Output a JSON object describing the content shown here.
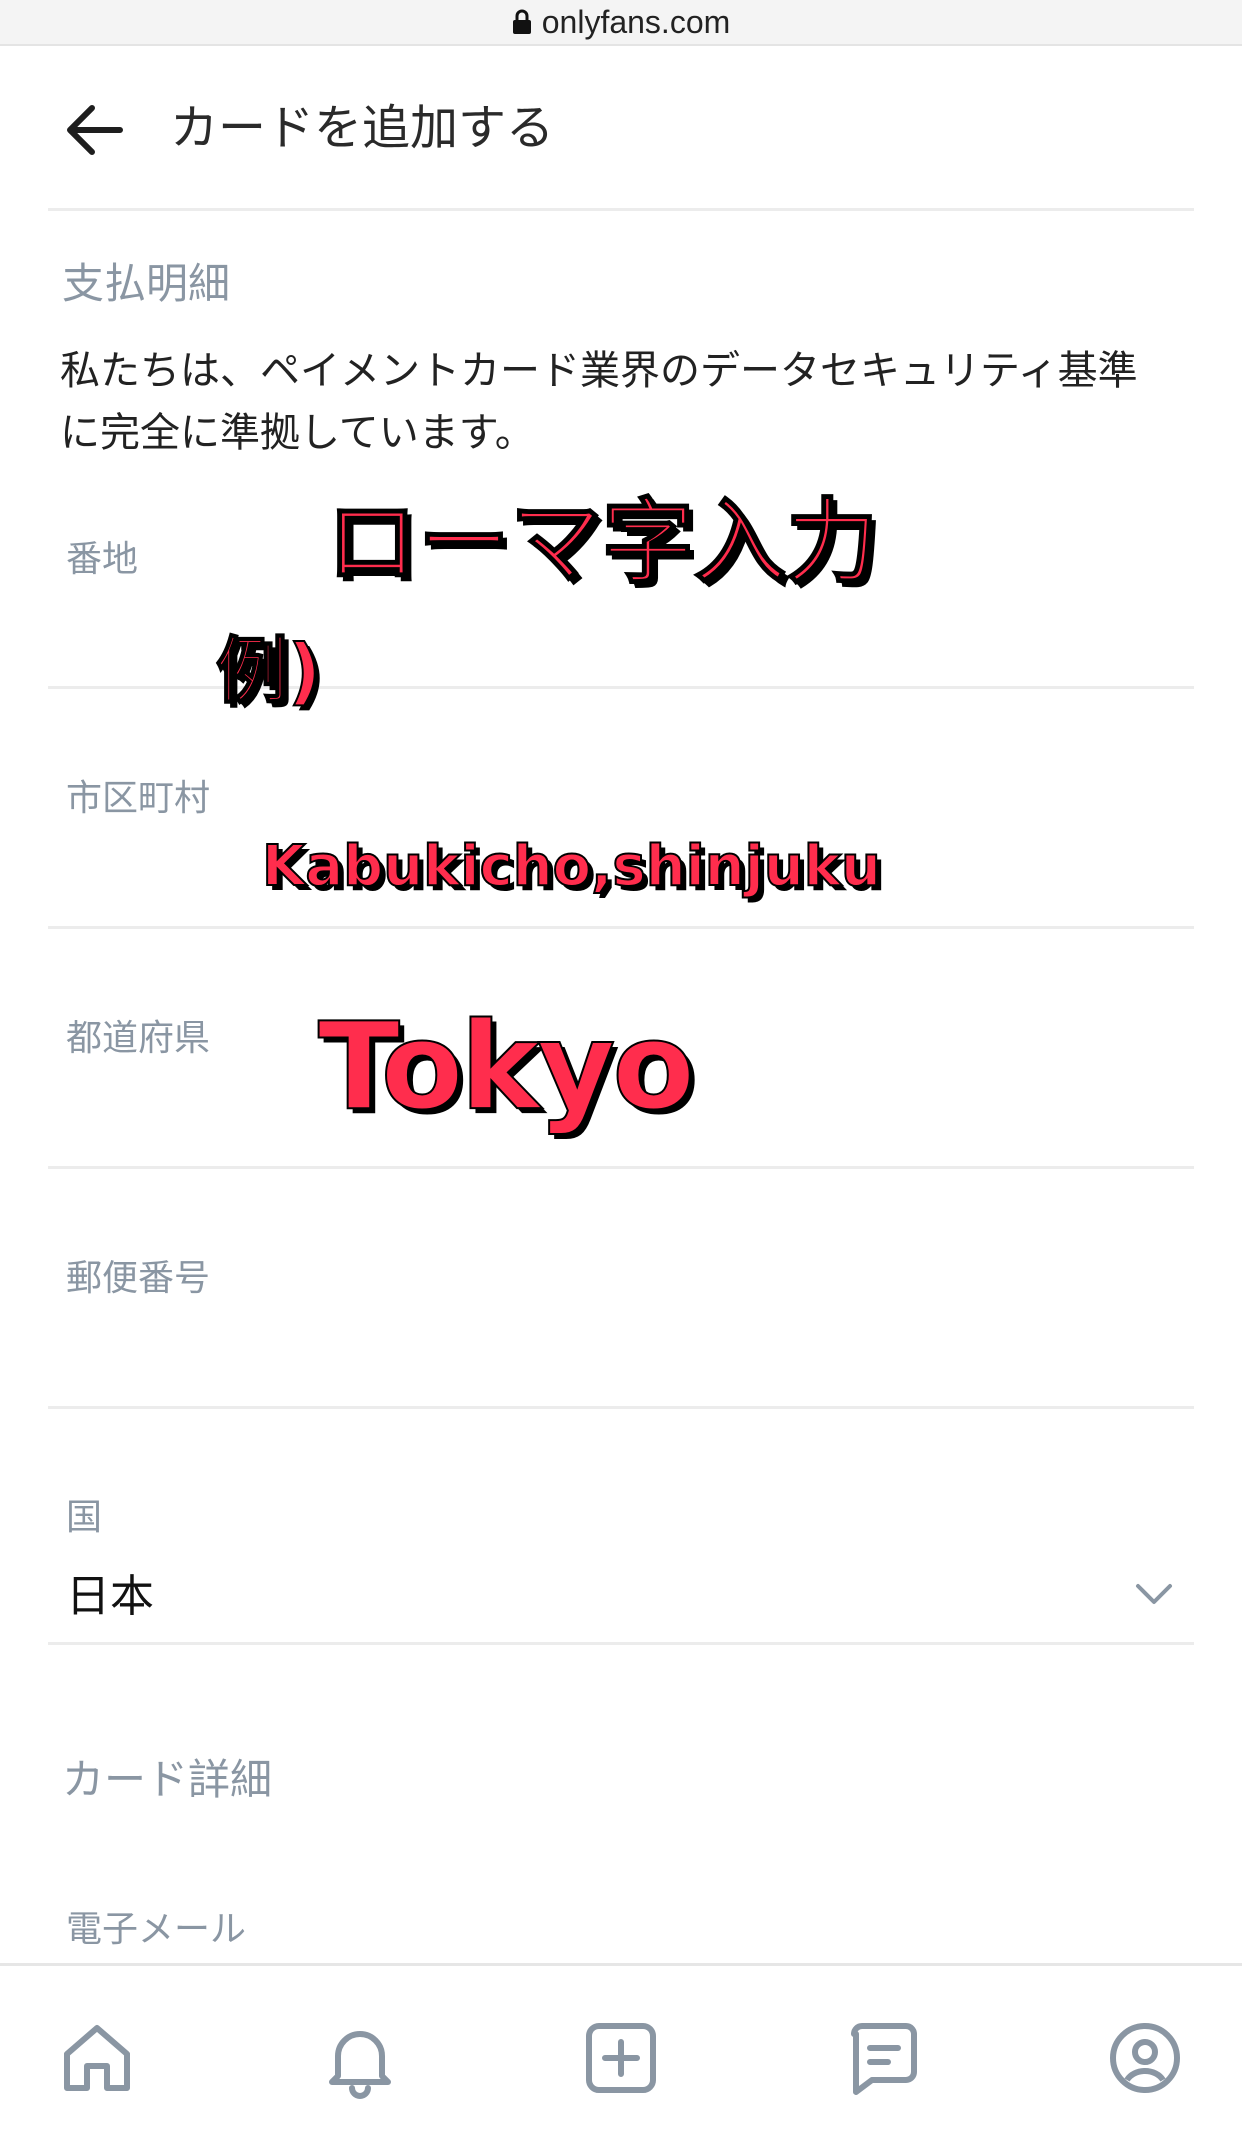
{
  "browser": {
    "url": "onlyfans.com"
  },
  "header": {
    "title": "カードを追加する"
  },
  "billing": {
    "section_title": "支払明細",
    "notice": "私たちは、ペイメントカード業界のデータセキュリティ基準に完全に準拠しています。",
    "fields": {
      "street": {
        "label": "番地",
        "value": ""
      },
      "city": {
        "label": "市区町村",
        "value": ""
      },
      "state": {
        "label": "都道府県",
        "value": ""
      },
      "postal": {
        "label": "郵便番号",
        "value": ""
      },
      "country": {
        "label": "国",
        "value": "日本"
      }
    }
  },
  "card": {
    "section_title": "カード詳細",
    "email_label": "電子メール"
  },
  "overlay": {
    "romaji": "ローマ字入力",
    "example": "例)",
    "city_example": "Kabukicho,shinjuku",
    "state_example": "Tokyo",
    "color": "#ff2d4d"
  },
  "bottom_nav": {
    "icons": [
      "home-icon",
      "bell-icon",
      "plus-square-icon",
      "message-icon",
      "profile-icon"
    ]
  }
}
